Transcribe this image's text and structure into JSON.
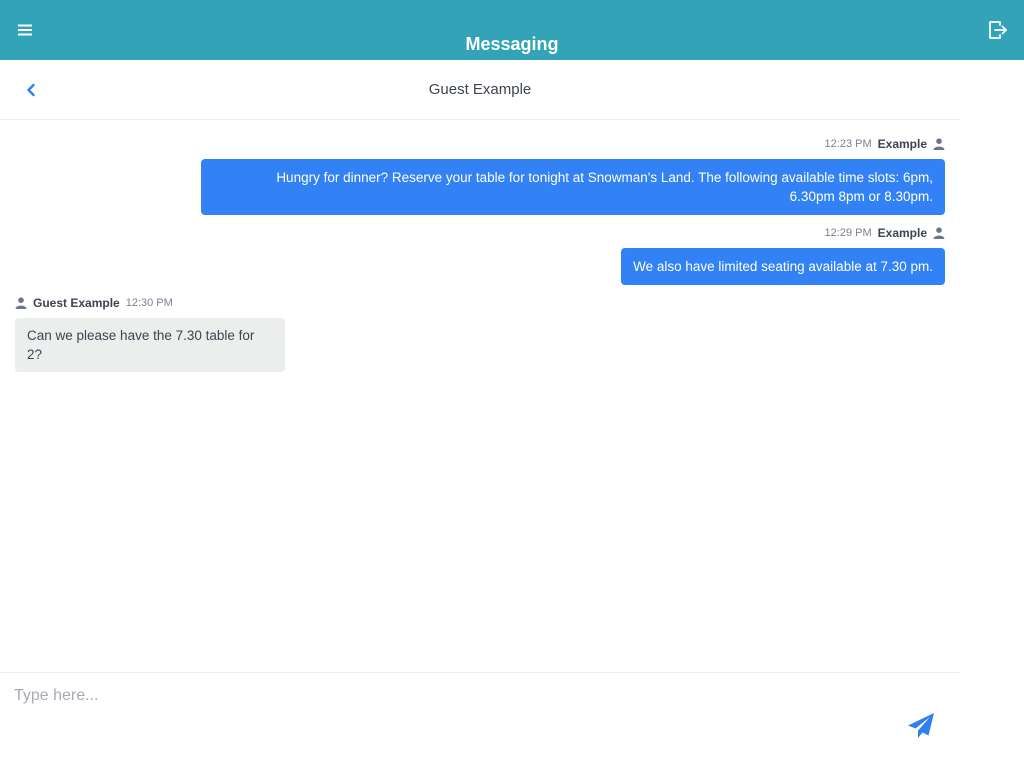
{
  "app_bar": {
    "title": "Messaging",
    "menu_icon": "hamburger-menu-icon",
    "logout_icon": "logout-icon",
    "color": "#33a3b7"
  },
  "conversation": {
    "title": "Guest Example",
    "back_icon": "chevron-left-icon"
  },
  "messages": [
    {
      "direction": "outgoing",
      "time": "12:23 PM",
      "sender": "Example",
      "line1": "Hungry for dinner? Reserve your table for tonight at Snowman's Land. The following available time slots: 6pm,",
      "line2": "6.30pm 8pm or 8.30pm."
    },
    {
      "direction": "outgoing",
      "time": "12:29 PM",
      "sender": "Example",
      "text": "We also have limited seating available at 7.30 pm."
    },
    {
      "direction": "incoming",
      "time": "12:30 PM",
      "sender": "Guest Example",
      "text": "Can we please have the 7.30 table for 2?"
    }
  ],
  "composer": {
    "placeholder": "Type here...",
    "value": "",
    "send_icon": "paper-plane-icon"
  },
  "colors": {
    "outgoing_bubble": "#3282f6",
    "incoming_bubble": "#eceded",
    "accent": "#2f80ed"
  }
}
